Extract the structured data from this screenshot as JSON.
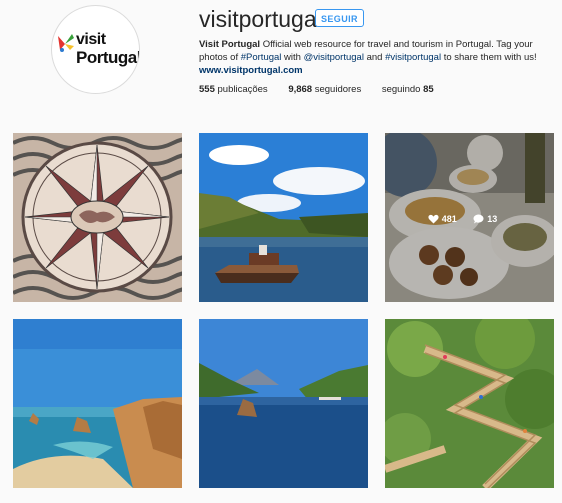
{
  "profile": {
    "username": "visitportugal",
    "follow_label": "SEGUIR",
    "logo_line1": "visit",
    "logo_line2": "Portugal",
    "bio_name": "Visit Portugal",
    "bio_text1": " Official web resource for travel and tourism in Portugal. Tag your photos of ",
    "bio_tag1": "#Portugal",
    "bio_text2": " with ",
    "bio_tag2": "@visitportugal",
    "bio_text3": " and ",
    "bio_tag3": "#visitportugal",
    "bio_text4": " to share them with us!",
    "website": "www.visitportugal.com"
  },
  "stats": {
    "posts_count": "555",
    "posts_label": " publicações",
    "followers_count": "9,868",
    "followers_label": " seguidores",
    "following_label": "seguindo ",
    "following_count": "85"
  },
  "grid": {
    "hover_post": {
      "likes": "481",
      "comments": "13"
    },
    "tiles": [
      {
        "name": "compass-rose-mosaic"
      },
      {
        "name": "douro-river-boat"
      },
      {
        "name": "portuguese-food-table"
      },
      {
        "name": "algarve-coast-cliffs"
      },
      {
        "name": "azores-bay"
      },
      {
        "name": "wooden-walkway"
      }
    ]
  },
  "colors": {
    "link": "#003569",
    "accent": "#3897f0",
    "background": "#fafafa"
  }
}
